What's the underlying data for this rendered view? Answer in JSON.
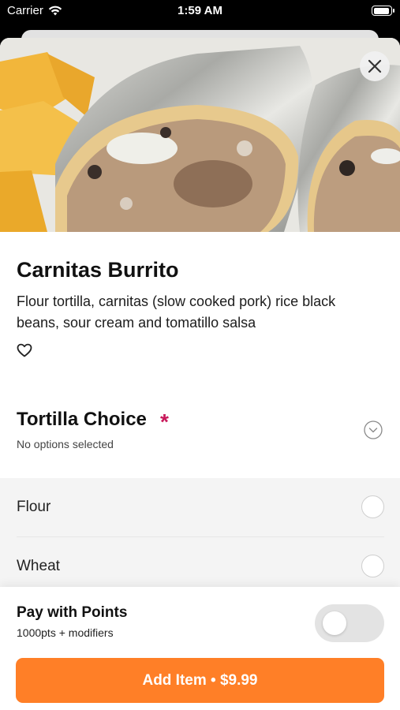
{
  "status": {
    "carrier": "Carrier",
    "time": "1:59 AM"
  },
  "item": {
    "title": "Carnitas Burrito",
    "description": "Flour tortilla, carnitas (slow cooked pork) rice black beans, sour cream and tomatillo salsa"
  },
  "tortilla": {
    "title": "Tortilla Choice",
    "required_mark": "*",
    "subtitle": "No options selected",
    "options": [
      {
        "label": "Flour"
      },
      {
        "label": "Wheat"
      }
    ]
  },
  "points": {
    "title": "Pay with Points",
    "subtitle": "1000pts + modifiers",
    "enabled": false
  },
  "cta": {
    "label": "Add Item • $9.99"
  },
  "colors": {
    "accent": "#ff7f27",
    "required": "#c8185a"
  },
  "icons": [
    "wifi-icon",
    "battery-icon",
    "close-icon",
    "heart-icon",
    "chevron-down-icon"
  ]
}
